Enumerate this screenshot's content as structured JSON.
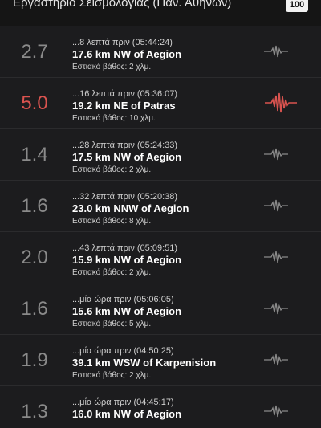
{
  "header": {
    "title": "Εργαστήριο Σεισμολογίας (Παν. Αθηνών)",
    "count": "100"
  },
  "colors": {
    "background": "#151515",
    "list_background": "#1c1c1e",
    "magnitude_normal": "#8a8a8a",
    "magnitude_strong": "#d9534f"
  },
  "earthquakes": [
    {
      "magnitude": "2.7",
      "time": "...8 λεπτά πριν (05:44:24)",
      "location": "17.6 km NW of Aegion",
      "depth": "Εστιακό βάθος: 2 χλμ.",
      "icon": "seismograph-icon"
    },
    {
      "magnitude": "5.0",
      "time": "...16 λεπτά πριν (05:36:07)",
      "location": "19.2 km NE of Patras",
      "depth": "Εστιακό βάθος: 10 χλμ.",
      "icon": "seismograph-icon"
    },
    {
      "magnitude": "1.4",
      "time": "...28 λεπτά πριν (05:24:33)",
      "location": "17.5 km NW of Aegion",
      "depth": "Εστιακό βάθος: 2 χλμ.",
      "icon": "seismograph-icon"
    },
    {
      "magnitude": "1.6",
      "time": "...32 λεπτά πριν (05:20:38)",
      "location": "23.0 km NNW of Aegion",
      "depth": "Εστιακό βάθος: 8 χλμ.",
      "icon": "seismograph-icon"
    },
    {
      "magnitude": "2.0",
      "time": "...43 λεπτά πριν (05:09:51)",
      "location": "15.9 km NW of Aegion",
      "depth": "Εστιακό βάθος: 2 χλμ.",
      "icon": "seismograph-icon"
    },
    {
      "magnitude": "1.6",
      "time": "...μία ώρα πριν (05:06:05)",
      "location": "15.6 km NW of Aegion",
      "depth": "Εστιακό βάθος: 5 χλμ.",
      "icon": "seismograph-icon"
    },
    {
      "magnitude": "1.9",
      "time": "...μία ώρα πριν (04:50:25)",
      "location": "39.1 km WSW of Karpenision",
      "depth": "Εστιακό βάθος: 2 χλμ.",
      "icon": "seismograph-icon"
    },
    {
      "magnitude": "1.3",
      "time": "...μία ώρα πριν (04:45:17)",
      "location": "16.0 km NW of Aegion",
      "depth": "",
      "icon": "seismograph-icon"
    }
  ]
}
